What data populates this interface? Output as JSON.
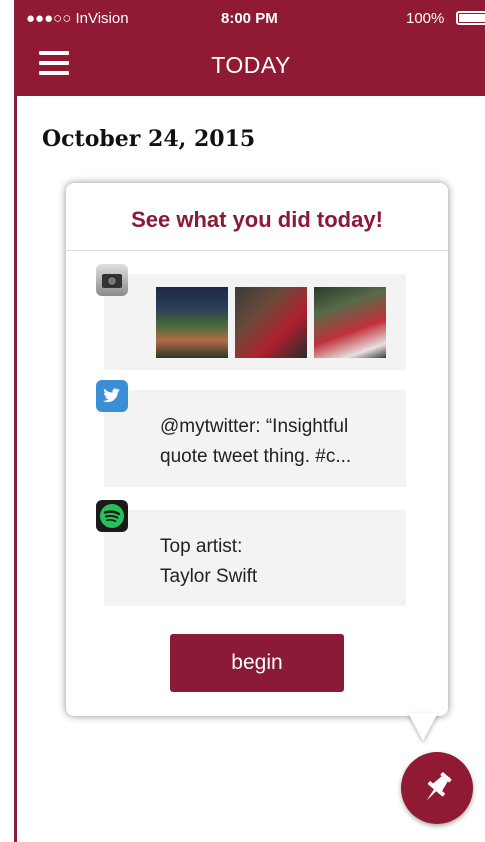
{
  "status_bar": {
    "carrier": "●●●○○ InVision",
    "time": "8:00 PM",
    "battery": "100%"
  },
  "app_bar": {
    "title": "TODAY",
    "menu_icon": "hamburger-icon"
  },
  "date": "October 24, 2015",
  "card": {
    "title": "See what you did today!",
    "sections": {
      "photos": {
        "icon": "camera-icon",
        "photo_count": 3
      },
      "tweet": {
        "icon": "twitter-icon",
        "text": "@mytwitter: “Insightful quote tweet thing. #c..."
      },
      "music": {
        "icon": "spotify-icon",
        "line1": "Top artist:",
        "line2": "Taylor Swift"
      }
    },
    "begin_label": "begin"
  },
  "fab": {
    "icon": "pushpin-icon"
  },
  "colors": {
    "brand": "#901a33",
    "brand_text": "#8a1a35",
    "section_bg": "#f3f3f3",
    "twitter": "#3b8fd4",
    "spotify": "#26c15a"
  }
}
